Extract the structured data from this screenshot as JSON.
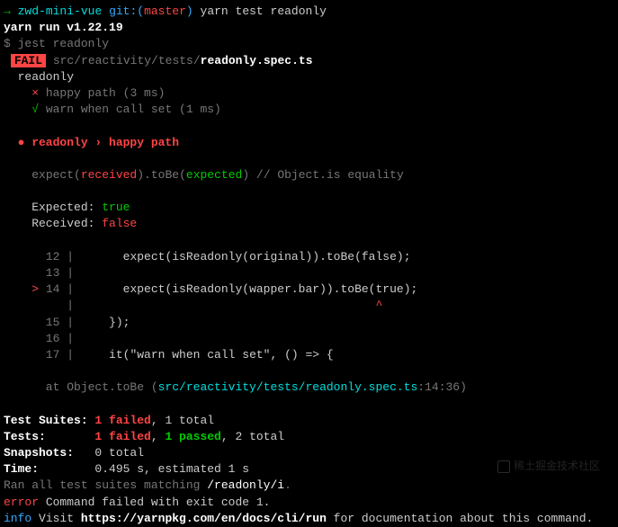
{
  "prompt": {
    "arrow": "→",
    "dir": "zwd-mini-vue",
    "git_prefix": "git:(",
    "branch": "master",
    "git_suffix": ")",
    "cmd": "yarn test readonly"
  },
  "yarn_run": "yarn run v1.22.19",
  "jest_line": {
    "dollar": "$",
    "cmd": "jest readonly"
  },
  "fail_badge": "FAIL",
  "fail_path_prefix": " src/reactivity/tests/",
  "fail_path_file": "readonly.spec.ts",
  "suite_name": "  readonly",
  "test1": {
    "cross": "    ×",
    "name": " happy path ",
    "time": "(3 ms)"
  },
  "test2": {
    "check": "    √",
    "name": " warn when call set ",
    "time": "(1 ms)"
  },
  "fail_header": {
    "bullet": "  ●",
    "text": " readonly › happy path"
  },
  "expect_line": {
    "indent": "    ",
    "expect": "expect(",
    "received": "received",
    "mid": ").",
    "tobe": "toBe",
    "open2": "(",
    "expected": "expected",
    "close": ")",
    "comment": " // Object.is equality"
  },
  "expected_label": "    Expected: ",
  "expected_val": "true",
  "received_label": "    Received: ",
  "received_val": "false",
  "code": {
    "l12": {
      "num": "      12",
      "pipe": " |",
      "code": "       expect(isReadonly(original)).toBe(false);"
    },
    "l13": {
      "num": "      13",
      "pipe": " |"
    },
    "l14": {
      "marker": "    >",
      "num": " 14",
      "pipe": " |",
      "code": "       expect(isReadonly(wapper.bar)).toBe(true);"
    },
    "caret": {
      "spaces": "        ",
      "pipe": " |",
      "caret": "                                           ^"
    },
    "l15": {
      "num": "      15",
      "pipe": " |",
      "code": "     });"
    },
    "l16": {
      "num": "      16",
      "pipe": " |"
    },
    "l17": {
      "num": "      17",
      "pipe": " |",
      "code": "     it(\"warn when call set\", () => {"
    }
  },
  "at_line": {
    "prefix": "      at Object.toBe (",
    "path": "src/reactivity/tests/readonly.spec.ts",
    "suffix": ":14:36)"
  },
  "summary": {
    "suites_label": "Test Suites: ",
    "suites_fail": "1 failed",
    "suites_rest": ", 1 total",
    "tests_label": "Tests:       ",
    "tests_fail": "1 failed",
    "tests_mid": ", ",
    "tests_pass": "1 passed",
    "tests_rest": ", 2 total",
    "snapshots_label": "Snapshots:   ",
    "snapshots_val": "0 total",
    "time_label": "Time:        ",
    "time_val": "0.495 s, estimated 1 s"
  },
  "ran_line": {
    "prefix": "Ran all test suites matching ",
    "pattern": "/readonly/i",
    "suffix": "."
  },
  "error_line": {
    "label": "error",
    "msg": " Command failed with exit code 1."
  },
  "info_line": {
    "label": "info",
    "pre": " Visit ",
    "url": "https://yarnpkg.com/en/docs/cli/run",
    "post": " for documentation about this command."
  },
  "watermark": "稀土掘金技术社区"
}
